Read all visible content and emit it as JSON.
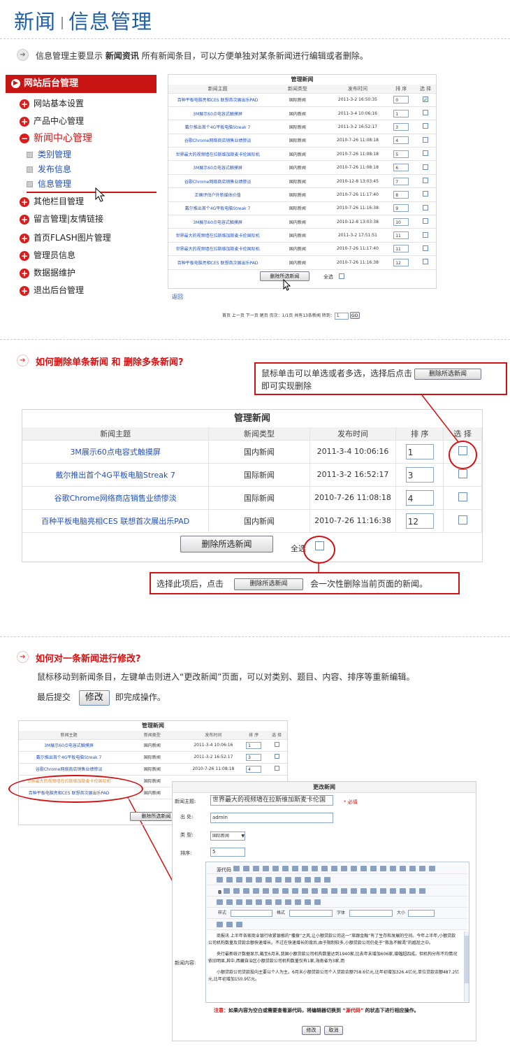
{
  "header": {
    "title_main": "新闻",
    "title_sub": "信息管理"
  },
  "intro": {
    "pre": "信息管理主要显示",
    "bold": "新闻资讯",
    "post": "所有新闻条目，可以方便单独对某条新闻进行编辑或者删除。"
  },
  "sidebar": {
    "header": "网站后台管理",
    "items": [
      "网站基本设置",
      "产品中心管理",
      "新闻中心管理",
      "其他栏目管理",
      "留言管理|友情链接",
      "首页FLASH图片管理",
      "管理员信息",
      "数据据维护",
      "退出后台管理"
    ],
    "subitems": [
      "类别管理",
      "发布信息",
      "信息管理"
    ]
  },
  "small_table": {
    "title": "管理新闻",
    "headers": [
      "新闻主题",
      "新闻类型",
      "发布时间",
      "排 序",
      "选 择"
    ],
    "rows": [
      [
        "百种平板电脑亮相CES 联想首次展出乐PAD",
        "国际新闻",
        "2011-3-2 16:50:35",
        "0"
      ],
      [
        "3M展示60点电容式触摸屏",
        "国内新闻",
        "2011-3-4 10:06:16",
        "1"
      ],
      [
        "戴尔推出首个4G平板电脑Streak 7",
        "国际新闻",
        "2011-3-2 16:52:17",
        "3"
      ],
      [
        "谷歌Chrome网络商店销售业绩惨淡",
        "国际新闻",
        "2010-7-26 11:08:18",
        "4"
      ],
      [
        "世界最大的视频墙在拉斯维加斯麦卡伦国际机",
        "国内新闻",
        "2010-7-26 11:08:18",
        "5"
      ],
      [
        "3M展示60点电容式触摸屏",
        "国内新闻",
        "2010-7-26 11:08:18",
        "6"
      ],
      [
        "谷歌Chrome网络商店销售业绩惨淡",
        "国际新闻",
        "2010-12-8 13:03:45",
        "7"
      ],
      [
        "正确评估户外新媒体价值",
        "国际新闻",
        "2010-7-26 11:17:40",
        "8"
      ],
      [
        "戴尔推出首个4G平板电脑Streak 7",
        "国际新闻",
        "2010-7-26 11:16:38",
        "9"
      ],
      [
        "3M展示60点电容式触摸屏",
        "国内新闻",
        "2010-12-8 13:03:38",
        "10"
      ],
      [
        "世界最大的视频墙在拉斯维加斯麦卡伦国际机",
        "国内新闻",
        "2011-3-2 17:51:51",
        "11"
      ],
      [
        "世界最大的视频墙在拉斯维加斯麦卡伦国际机",
        "国内新闻",
        "2010-7-26 11:17:40",
        "11"
      ],
      [
        "百种平板电脑亮相CES 联想首次展出乐PAD",
        "国内新闻",
        "2010-7-26 11:16:38",
        "12"
      ]
    ],
    "delete_btn": "删除所选新闻",
    "select_all": "全选",
    "back": "返回",
    "pager": "首页 上一页 下一页 尾页 页次：1/1页 共有13条新闻 转到：",
    "page_input": "1",
    "go": "GO"
  },
  "section2": {
    "heading": "如何删除单条新闻 和 删除多条新闻?",
    "callout1_a": "鼠标单击可以单选或者多选，选择后点击",
    "callout1_btn": "删除所选新闻",
    "callout1_b": "即可实现删除",
    "table_title": "管理新闻",
    "headers": [
      "新闻主题",
      "新闻类型",
      "发布时间",
      "排 序",
      "选 择"
    ],
    "rows": [
      [
        "3M展示60点电容式触摸屏",
        "国内新闻",
        "2011-3-4 10:06:16",
        "1"
      ],
      [
        "戴尔推出首个4G平板电脑Streak 7",
        "国际新闻",
        "2011-3-2 16:52:17",
        "3"
      ],
      [
        "谷歌Chrome网络商店销售业绩惨淡",
        "国际新闻",
        "2010-7-26 11:08:18",
        "4"
      ],
      [
        "百种平板电脑亮相CES 联想首次展出乐PAD",
        "国内新闻",
        "2010-7-26 11:16:38",
        "12"
      ]
    ],
    "delete_btn": "删除所选新闻",
    "select_all": "全选",
    "callout2_a": "选择此项后，点击",
    "callout2_btn": "删除所选新闻",
    "callout2_b": "会一次性删除当前页面的新闻。"
  },
  "section3": {
    "heading": "如何对一条新闻进行修改?",
    "desc1": "鼠标移动到新闻条目，左键单击则进入“更改新闻”页面，可以对类别、题目、内容、排序等重新编辑。",
    "desc2a": "最后提交",
    "modify_btn": "修改",
    "desc2b": "即完成操作。",
    "mini_title": "管理新闻",
    "mini_headers": [
      "新闻主题",
      "新闻类型",
      "发布时间",
      "排 序",
      "选 择"
    ],
    "mini_rows": [
      [
        "3M展示60点电容式触摸屏",
        "国内新闻",
        "2011-3-4 10:06:16",
        "1"
      ],
      [
        "戴尔推出首个4G平板电脑Streak 7",
        "国际新闻",
        "2011-3-2 16:52:17",
        "3"
      ],
      [
        "谷歌Chrome网络商店销售业绩惨淡",
        "国际新闻",
        "2010-7-26 11:08:18",
        "4"
      ],
      [
        "世界最大的视频墙在拉斯维加斯麦卡伦国际机",
        "国际新闻",
        "",
        ""
      ],
      [
        "百种平板电脑亮相CES 联想首次展出乐PAD",
        "国内新闻",
        "",
        ""
      ]
    ],
    "mini_delete": "删除所选新闻",
    "edit": {
      "title": "更改新闻",
      "subject_label": "新闻主题:",
      "subject_value": "世界最大的视频墙在拉斯维加斯麦卡伦国",
      "required": "* 必填",
      "source_label": "出 处:",
      "source_value": "admin",
      "type_label": "类 型:",
      "type_value": "国际新闻",
      "order_label": "排序:",
      "order_value": "5",
      "content_label": "新闻内容:",
      "source_btn": "源代码",
      "style_label": "样式",
      "format_label": "格式",
      "font_label": "字体",
      "size_label": "大小",
      "para1": "商报讯 上半年各家商业银行收紧银根的“撒拨”之风,让小额贷款公司这一“草跟金融”有了生存和发展的空间。今年上半年,小额贷款公司机构数量及贷款余额快速增长。不过在快速增长的背后,由于限制较多,小额贷款公司仍处于“救急不解渴”的尴尬之中。",
      "para2": "央行最新统计数据显示,截至6月末,我国小额贷款公司机构数量达到1940家,比去年末增加606家,增幅超四成。但机构分布不均情况依旧明显,其中,西藏自治区小额贷款公司机构数量仅有1家,海南省为3家,而",
      "para3": "小额贷款公司贷款投向主要以个人为主。6月末小额贷款公司个人贷款余额758.6亿元,比年初增加326.4亿元,单位贷款余额487.2亿元,比年初增加150.9亿元。",
      "note_prefix": "注意：",
      "note_a": "如果内容为空白或需要查看源代码，将编辑器切换到",
      "note_code": "“源代码”",
      "note_b": "的状态下进行相应操作。",
      "submit": "修改",
      "cancel": "取消"
    }
  }
}
